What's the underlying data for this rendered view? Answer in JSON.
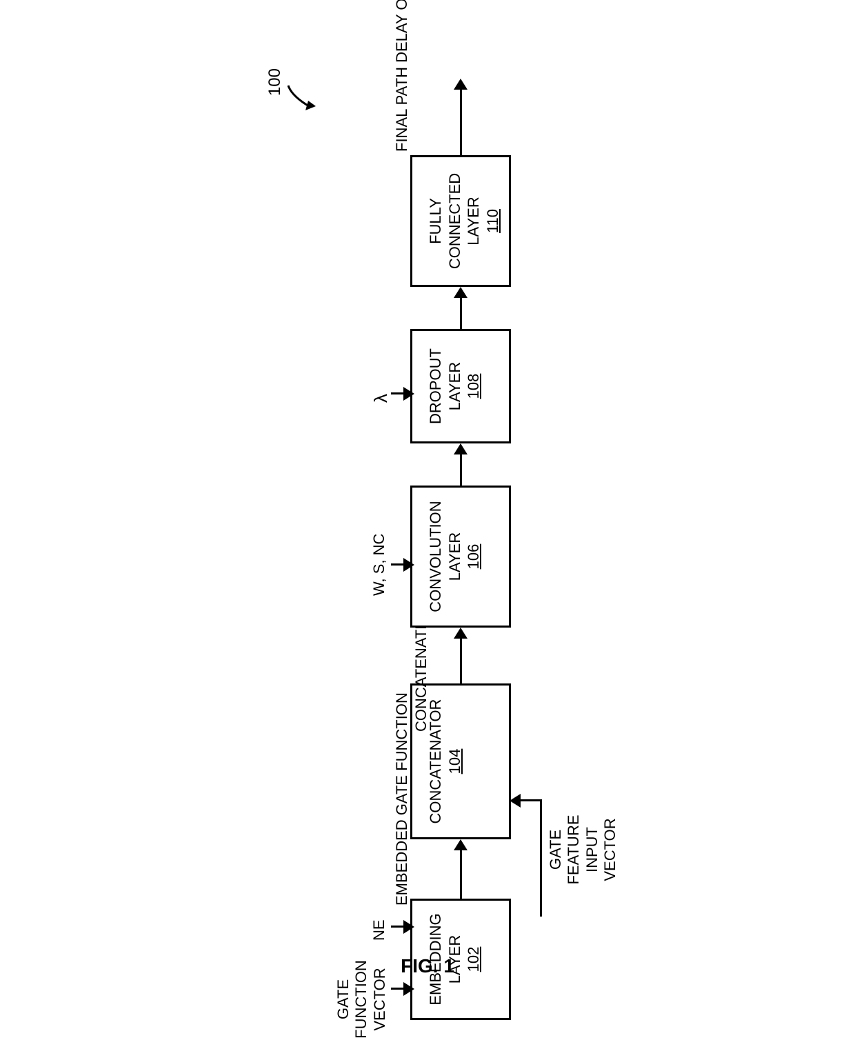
{
  "diagram_number": "100",
  "figure_label": "FIG. 1",
  "blocks": {
    "embedding": {
      "label": "EMBEDDING LAYER",
      "ref": "102"
    },
    "concatenator": {
      "label": "CONCATENATOR",
      "ref": "104"
    },
    "convolution": {
      "label": "CONVOLUTION LAYER",
      "ref": "106"
    },
    "dropout": {
      "label": "DROPOUT LAYER",
      "ref": "108"
    },
    "fc": {
      "label": "FULLY CONNECTED LAYER",
      "ref": "110"
    }
  },
  "inputs": {
    "gate_function": "GATE FUNCTION VECTOR",
    "ne": "NE",
    "wsnc": "W, S, NC",
    "lambda": "λ",
    "gate_feature": "GATE FEATURE INPUT VECTOR"
  },
  "labels": {
    "embedded_gate": "EMBEDDED GATE FUNCTION",
    "concat_vector": "CONCATENATED VECTOR"
  },
  "output": "FINAL PATH DELAY OUTPUT"
}
